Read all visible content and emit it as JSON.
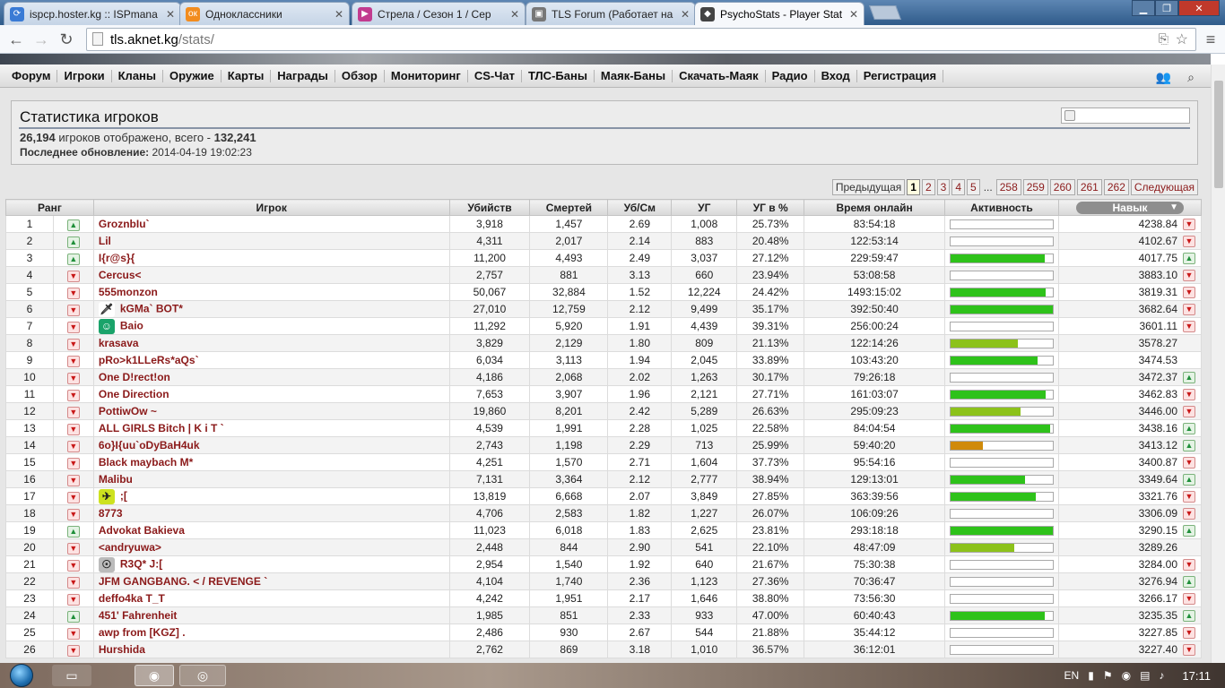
{
  "browser": {
    "tabs": [
      {
        "title": "ispcp.hoster.kg :: ISPmana",
        "favicon": "ispcp-icon",
        "color": "#3a7bd5"
      },
      {
        "title": "Одноклассники",
        "favicon": "odnoklassniki-icon",
        "color": "#f28c1e"
      },
      {
        "title": "Стрела / Сезон 1 / Сер",
        "favicon": "video-icon",
        "color": "#c23b8f"
      },
      {
        "title": "TLS Forum (Работает на I",
        "favicon": "forum-icon",
        "color": "#777777"
      },
      {
        "title": "PsychoStats - Player Stats",
        "favicon": "psychostats-icon",
        "color": "#444444"
      }
    ],
    "url_host": "tls.aknet.kg",
    "url_path": "/stats/"
  },
  "menu": [
    "Форум",
    "Игроки",
    "Кланы",
    "Оружие",
    "Карты",
    "Награды",
    "Обзор",
    "Мониторинг",
    "CS-Чат",
    "ТЛС-Баны",
    "Маяк-Баны",
    "Скачать-Маяк",
    "Радио",
    "Вход",
    "Регистрация"
  ],
  "stats": {
    "title": "Статистика игроков",
    "shown": "26,194",
    "shown_text": " игроков отображено, всего - ",
    "total": "132,241",
    "updated_label": "Последнее обновление:",
    "updated_value": " 2014-04-19 19:02:23"
  },
  "pager": {
    "prev": "Предыдущая",
    "pages": [
      "1",
      "2",
      "3",
      "4",
      "5"
    ],
    "dots": "...",
    "tail": [
      "258",
      "259",
      "260",
      "261",
      "262"
    ],
    "next": "Следующая",
    "current": "1"
  },
  "columns": [
    "Ранг",
    "Игрок",
    "Убийств",
    "Смертей",
    "Уб/См",
    "УГ",
    "УГ в %",
    "Время онлайн",
    "Активность",
    "Навык"
  ],
  "players": [
    {
      "rank": "1",
      "trend": "up",
      "name": "GroznbIu`",
      "kills": "3,918",
      "deaths": "1,457",
      "kd": "2.69",
      "hs": "1,008",
      "hsp": "25.73%",
      "online": "83:54:18",
      "activity": 0,
      "skill": "4238.84",
      "strend": "down"
    },
    {
      "rank": "2",
      "trend": "up",
      "name": "Lil",
      "kills": "4,311",
      "deaths": "2,017",
      "kd": "2.14",
      "hs": "883",
      "hsp": "20.48%",
      "online": "122:53:14",
      "activity": 0,
      "skill": "4102.67",
      "strend": "down"
    },
    {
      "rank": "3",
      "trend": "up",
      "name": "I{r@s}{",
      "kills": "11,200",
      "deaths": "4,493",
      "kd": "2.49",
      "hs": "3,037",
      "hsp": "27.12%",
      "online": "229:59:47",
      "activity": 92,
      "skill": "4017.75",
      "strend": "up"
    },
    {
      "rank": "4",
      "trend": "down",
      "name": "Cercus<",
      "kills": "2,757",
      "deaths": "881",
      "kd": "3.13",
      "hs": "660",
      "hsp": "23.94%",
      "online": "53:08:58",
      "activity": 0,
      "skill": "3883.10",
      "strend": "down"
    },
    {
      "rank": "5",
      "trend": "down",
      "name": "555monzon",
      "kills": "50,067",
      "deaths": "32,884",
      "kd": "1.52",
      "hs": "12,224",
      "hsp": "24.42%",
      "online": "1493:15:02",
      "activity": 93,
      "skill": "3819.31",
      "strend": "down"
    },
    {
      "rank": "6",
      "trend": "down",
      "name": "kGMa` BOT*",
      "kills": "27,010",
      "deaths": "12,759",
      "kd": "2.12",
      "hs": "9,499",
      "hsp": "35.17%",
      "online": "392:50:40",
      "activity": 100,
      "skill": "3682.64",
      "strend": "down",
      "avatar": "knife-icon"
    },
    {
      "rank": "7",
      "trend": "down",
      "name": "Baio",
      "kills": "11,292",
      "deaths": "5,920",
      "kd": "1.91",
      "hs": "4,439",
      "hsp": "39.31%",
      "online": "256:00:24",
      "activity": 0,
      "skill": "3601.11",
      "strend": "down",
      "avatar": "smiley-icon"
    },
    {
      "rank": "8",
      "trend": "down",
      "name": "krasava",
      "kills": "3,829",
      "deaths": "2,129",
      "kd": "1.80",
      "hs": "809",
      "hsp": "21.13%",
      "online": "122:14:26",
      "activity": 66,
      "skill": "3578.27",
      "strend": "none",
      "color": "#8cc21a"
    },
    {
      "rank": "9",
      "trend": "down",
      "name": "pRo>k1LLeRs*aQs`",
      "kills": "6,034",
      "deaths": "3,113",
      "kd": "1.94",
      "hs": "2,045",
      "hsp": "33.89%",
      "online": "103:43:20",
      "activity": 85,
      "skill": "3474.53",
      "strend": "none"
    },
    {
      "rank": "10",
      "trend": "down",
      "name": "One D!rect!on",
      "kills": "4,186",
      "deaths": "2,068",
      "kd": "2.02",
      "hs": "1,263",
      "hsp": "30.17%",
      "online": "79:26:18",
      "activity": 0,
      "skill": "3472.37",
      "strend": "up"
    },
    {
      "rank": "11",
      "trend": "down",
      "name": "One Direction",
      "kills": "7,653",
      "deaths": "3,907",
      "kd": "1.96",
      "hs": "2,121",
      "hsp": "27.71%",
      "online": "161:03:07",
      "activity": 93,
      "skill": "3462.83",
      "strend": "down"
    },
    {
      "rank": "12",
      "trend": "down",
      "name": "PottiwOw ~",
      "kills": "19,860",
      "deaths": "8,201",
      "kd": "2.42",
      "hs": "5,289",
      "hsp": "26.63%",
      "online": "295:09:23",
      "activity": 68,
      "skill": "3446.00",
      "strend": "down",
      "color": "#8cc21a"
    },
    {
      "rank": "13",
      "trend": "down",
      "name": "ALL GIRLS Bitch | K i T `",
      "kills": "4,539",
      "deaths": "1,991",
      "kd": "2.28",
      "hs": "1,025",
      "hsp": "22.58%",
      "online": "84:04:54",
      "activity": 97,
      "skill": "3438.16",
      "strend": "up"
    },
    {
      "rank": "14",
      "trend": "down",
      "name": "6o}I{uu`oDyBaH4uk",
      "kills": "2,743",
      "deaths": "1,198",
      "kd": "2.29",
      "hs": "713",
      "hsp": "25.99%",
      "online": "59:40:20",
      "activity": 32,
      "skill": "3413.12",
      "strend": "up",
      "color": "#d08a0a"
    },
    {
      "rank": "15",
      "trend": "down",
      "name": "Black maybach M*",
      "kills": "4,251",
      "deaths": "1,570",
      "kd": "2.71",
      "hs": "1,604",
      "hsp": "37.73%",
      "online": "95:54:16",
      "activity": 0,
      "skill": "3400.87",
      "strend": "down"
    },
    {
      "rank": "16",
      "trend": "down",
      "name": "Malibu",
      "kills": "7,131",
      "deaths": "3,364",
      "kd": "2.12",
      "hs": "2,777",
      "hsp": "38.94%",
      "online": "129:13:01",
      "activity": 73,
      "skill": "3349.64",
      "strend": "up"
    },
    {
      "rank": "17",
      "trend": "down",
      "name": ";[",
      "kills": "13,819",
      "deaths": "6,668",
      "kd": "2.07",
      "hs": "3,849",
      "hsp": "27.85%",
      "online": "363:39:56",
      "activity": 83,
      "skill": "3321.76",
      "strend": "down",
      "avatar": "ct-icon"
    },
    {
      "rank": "18",
      "trend": "down",
      "name": "8773",
      "kills": "4,706",
      "deaths": "2,583",
      "kd": "1.82",
      "hs": "1,227",
      "hsp": "26.07%",
      "online": "106:09:26",
      "activity": 0,
      "skill": "3306.09",
      "strend": "down"
    },
    {
      "rank": "19",
      "trend": "up",
      "name": "Advokat Bakieva",
      "kills": "11,023",
      "deaths": "6,018",
      "kd": "1.83",
      "hs": "2,625",
      "hsp": "23.81%",
      "online": "293:18:18",
      "activity": 100,
      "skill": "3290.15",
      "strend": "up"
    },
    {
      "rank": "20",
      "trend": "down",
      "name": "<andryuwa>",
      "kills": "2,448",
      "deaths": "844",
      "kd": "2.90",
      "hs": "541",
      "hsp": "22.10%",
      "online": "48:47:09",
      "activity": 62,
      "skill": "3289.26",
      "strend": "none",
      "color": "#8cc21a"
    },
    {
      "rank": "21",
      "trend": "down",
      "name": "R3Q* J:[",
      "kills": "2,954",
      "deaths": "1,540",
      "kd": "1.92",
      "hs": "640",
      "hsp": "21.67%",
      "online": "75:30:38",
      "activity": 0,
      "skill": "3284.00",
      "strend": "down",
      "avatar": "alien-icon"
    },
    {
      "rank": "22",
      "trend": "down",
      "name": "JFM GANGBANG. < / REVENGE `",
      "kills": "4,104",
      "deaths": "1,740",
      "kd": "2.36",
      "hs": "1,123",
      "hsp": "27.36%",
      "online": "70:36:47",
      "activity": 0,
      "skill": "3276.94",
      "strend": "up"
    },
    {
      "rank": "23",
      "trend": "down",
      "name": "deffo4ka T_T",
      "kills": "4,242",
      "deaths": "1,951",
      "kd": "2.17",
      "hs": "1,646",
      "hsp": "38.80%",
      "online": "73:56:30",
      "activity": 0,
      "skill": "3266.17",
      "strend": "down"
    },
    {
      "rank": "24",
      "trend": "up",
      "name": "451' Fahrenheit",
      "kills": "1,985",
      "deaths": "851",
      "kd": "2.33",
      "hs": "933",
      "hsp": "47.00%",
      "online": "60:40:43",
      "activity": 92,
      "skill": "3235.35",
      "strend": "up"
    },
    {
      "rank": "25",
      "trend": "down",
      "name": "awp from [KGZ] .",
      "kills": "2,486",
      "deaths": "930",
      "kd": "2.67",
      "hs": "544",
      "hsp": "21.88%",
      "online": "35:44:12",
      "activity": 0,
      "skill": "3227.85",
      "strend": "down"
    },
    {
      "rank": "26",
      "trend": "down",
      "name": "Hurshida",
      "kills": "2,762",
      "deaths": "869",
      "kd": "3.18",
      "hs": "1,010",
      "hsp": "36.57%",
      "online": "36:12:01",
      "activity": 0,
      "skill": "3227.40",
      "strend": "down"
    }
  ],
  "taskbar": {
    "lang": "EN",
    "time": "17:11"
  },
  "colors": {
    "activity_default": "#2ec21a",
    "name": "#8b1a1a"
  }
}
